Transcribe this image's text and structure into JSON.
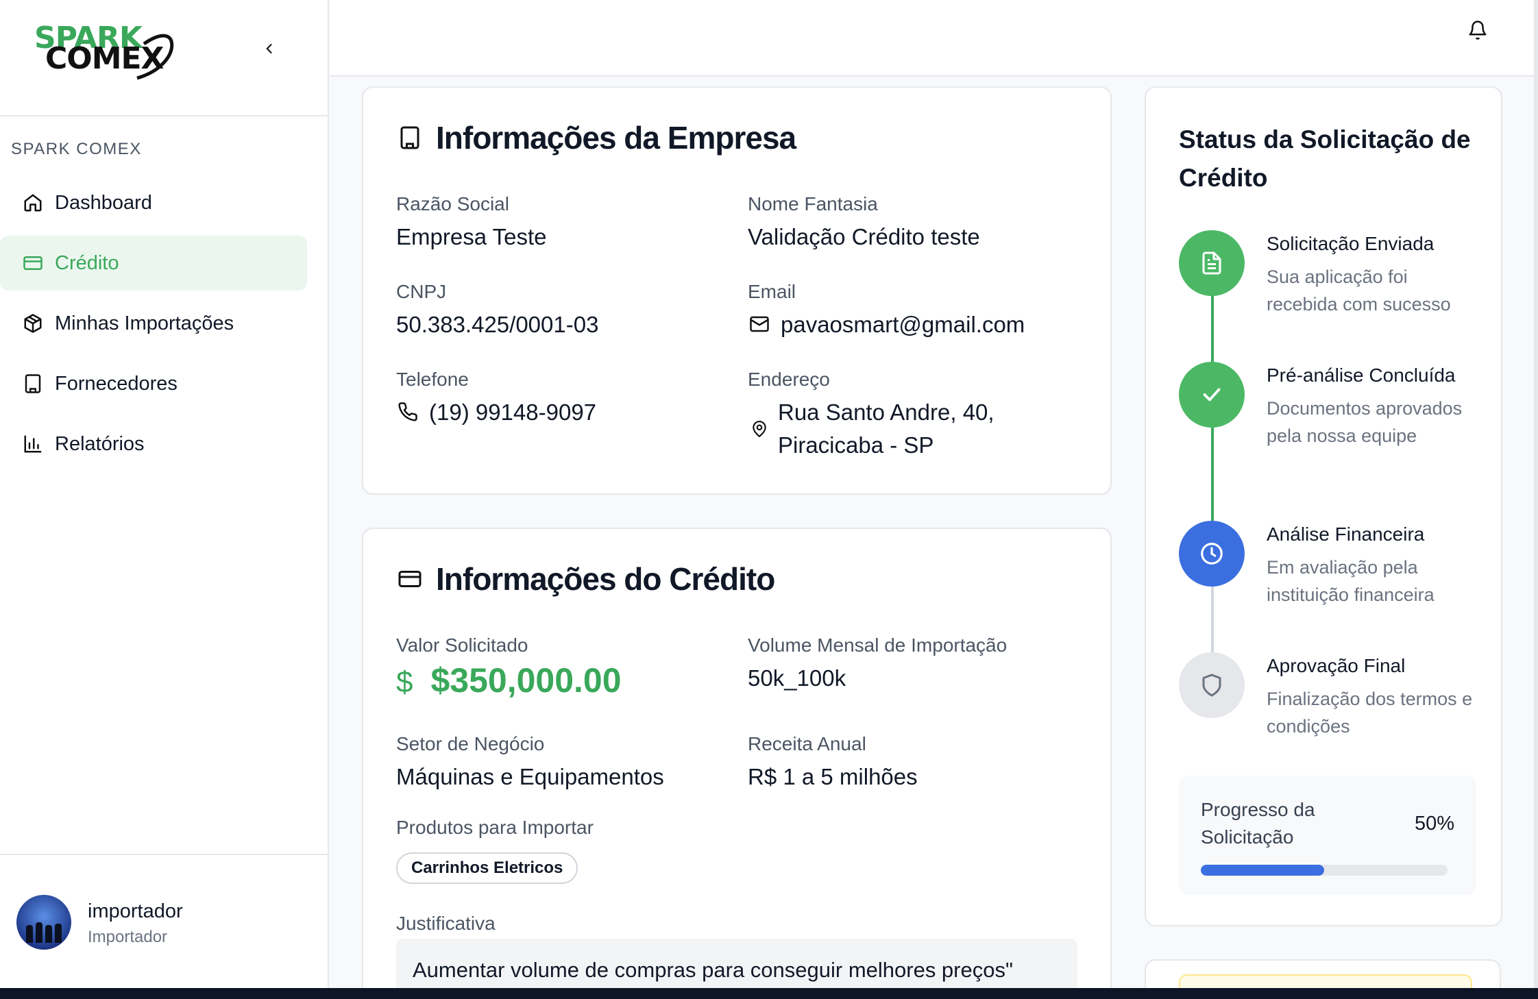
{
  "brand": {
    "line1": "SPARK",
    "line2": "COMEX"
  },
  "sidebar": {
    "section_label": "SPARK COMEX",
    "items": [
      {
        "label": "Dashboard",
        "icon": "home-icon",
        "active": false
      },
      {
        "label": "Crédito",
        "icon": "credit-card-icon",
        "active": true
      },
      {
        "label": "Minhas Importações",
        "icon": "package-icon",
        "active": false
      },
      {
        "label": "Fornecedores",
        "icon": "building-icon",
        "active": false
      },
      {
        "label": "Relatórios",
        "icon": "bar-chart-icon",
        "active": false
      }
    ],
    "user": {
      "name": "importador",
      "role": "Importador"
    }
  },
  "company": {
    "title": "Informações da Empresa",
    "razao_label": "Razão Social",
    "razao_value": "Empresa Teste",
    "fantasia_label": "Nome Fantasia",
    "fantasia_value": "Validação Crédito teste",
    "cnpj_label": "CNPJ",
    "cnpj_value": "50.383.425/0001-03",
    "email_label": "Email",
    "email_value": "pavaosmart@gmail.com",
    "phone_label": "Telefone",
    "phone_value": "(19) 99148-9097",
    "address_label": "Endereço",
    "address_line1": "Rua Santo Andre, 40,",
    "address_line2": "Piracicaba - SP"
  },
  "credit": {
    "title": "Informações do Crédito",
    "valor_label": "Valor Solicitado",
    "valor_currency": "$",
    "valor_value": "$350,000.00",
    "volume_label": "Volume Mensal de Importação",
    "volume_value": "50k_100k",
    "setor_label": "Setor de Negócio",
    "setor_value": "Máquinas e Equipamentos",
    "receita_label": "Receita Anual",
    "receita_value": "R$ 1 a 5 milhões",
    "produtos_label": "Produtos para Importar",
    "produtos": [
      "Carrinhos Eletricos"
    ],
    "justificativa_label": "Justificativa",
    "justificativa_value": "Aumentar volume de compras para conseguir melhores preços\""
  },
  "status": {
    "title": "Status da Solicitação de Crédito",
    "steps": [
      {
        "title": "Solicitação Enviada",
        "desc": "Sua aplicação foi recebida com sucesso",
        "state": "done",
        "icon": "document-icon"
      },
      {
        "title": "Pré-análise Concluída",
        "desc": "Documentos aprovados pela nossa equipe",
        "state": "done",
        "icon": "check-icon"
      },
      {
        "title": "Análise Financeira",
        "desc": "Em avaliação pela instituição financeira",
        "state": "current",
        "icon": "clock-icon"
      },
      {
        "title": "Aprovação Final",
        "desc": "Finalização dos termos e condições",
        "state": "pending",
        "icon": "shield-icon"
      }
    ],
    "progress_label": "Progresso da Solicitação",
    "progress_pct": "50%",
    "progress_value": 0.5
  },
  "colors": {
    "green": "#3aa85a",
    "blue": "#3b6fe0",
    "gray": "#e5e7eb"
  }
}
